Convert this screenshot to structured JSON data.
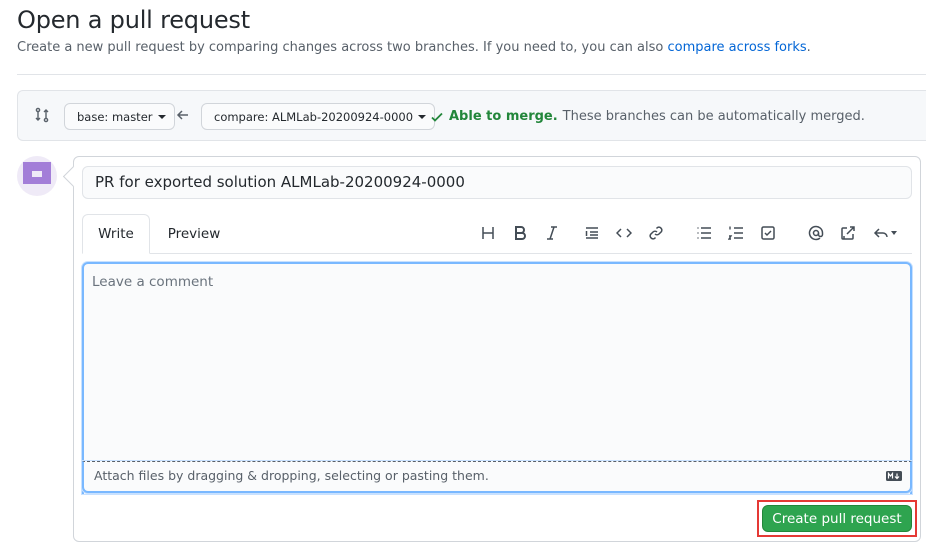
{
  "header": {
    "title": "Open a pull request",
    "subtitle_text": "Create a new pull request by comparing changes across two branches. If you need to, you can also ",
    "subtitle_link": "compare across forks",
    "subtitle_end": "."
  },
  "range": {
    "base_label": "base: master",
    "compare_label": "compare: ALMLab-20200924-0000",
    "merge_ok": "Able to merge.",
    "merge_text": "These branches can be automatically merged."
  },
  "form": {
    "title_value": "PR for exported solution ALMLab-20200924-0000",
    "tab_write": "Write",
    "tab_preview": "Preview",
    "comment_placeholder": "Leave a comment",
    "attach_text": "Attach files by dragging & dropping, selecting or pasting them.",
    "submit_label": "Create pull request"
  },
  "colors": {
    "accent": "#2ea44f",
    "link": "#0366d6",
    "success": "#22863a",
    "highlight_border": "#e53935"
  }
}
